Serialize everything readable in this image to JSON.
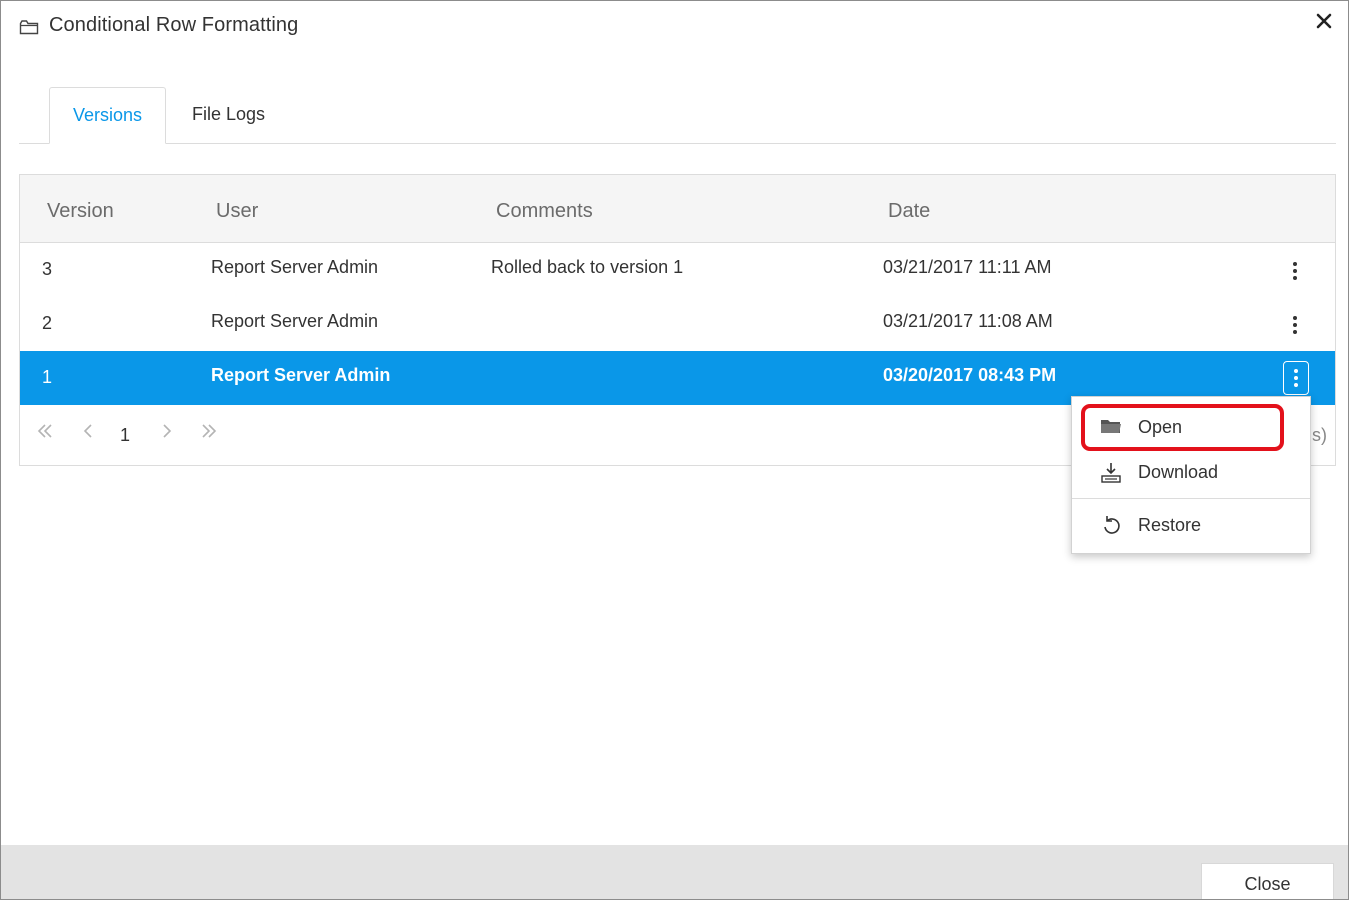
{
  "dialog": {
    "title": "Conditional Row Formatting",
    "close_label": "Close"
  },
  "tabs": [
    {
      "label": "Versions",
      "active": true
    },
    {
      "label": "File Logs",
      "active": false
    }
  ],
  "grid": {
    "columns": [
      "Version",
      "User",
      "Comments",
      "Date"
    ],
    "rows": [
      {
        "version": "3",
        "user": "Report Server Admin",
        "comments": "Rolled back to version 1",
        "date": "03/21/2017 11:11 AM",
        "selected": false
      },
      {
        "version": "2",
        "user": "Report Server Admin",
        "comments": "",
        "date": "03/21/2017 11:08 AM",
        "selected": false
      },
      {
        "version": "1",
        "user": "Report Server Admin",
        "comments": "",
        "date": "03/20/2017 08:43 PM",
        "selected": true
      }
    ]
  },
  "pager": {
    "current_page": "1",
    "info_partial": "s)"
  },
  "context_menu": {
    "items": [
      {
        "label": "Open",
        "icon": "folder-open-icon",
        "highlighted": true
      },
      {
        "label": "Download",
        "icon": "download-icon"
      },
      {
        "label": "Restore",
        "icon": "restore-icon"
      }
    ]
  },
  "colors": {
    "accent": "#0a97e8",
    "highlight_border": "#e3111b",
    "footer_bg": "#e3e3e3"
  }
}
